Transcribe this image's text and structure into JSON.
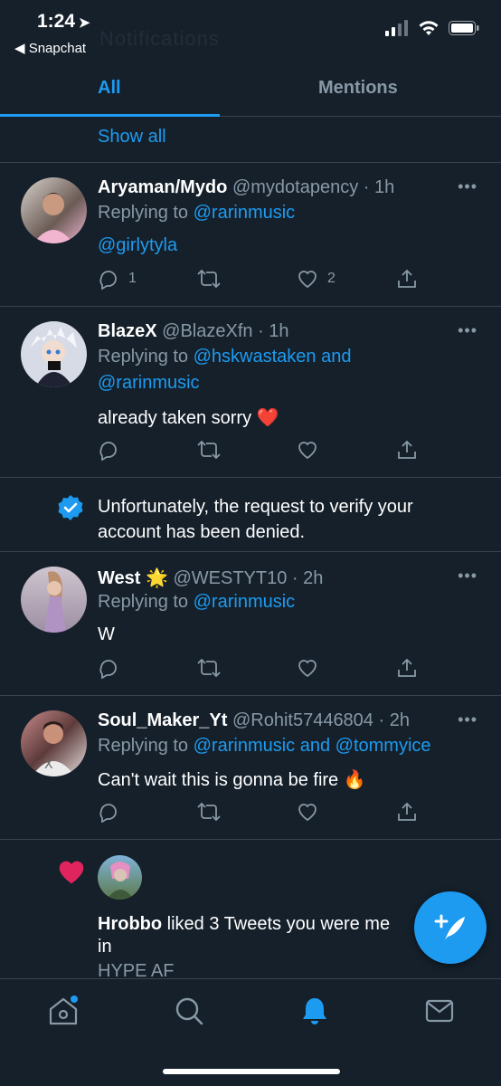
{
  "status_bar": {
    "time": "1:24",
    "back_app": "Snapchat"
  },
  "ghost_header": {
    "title": "Notifications",
    "subtitle": ""
  },
  "tabs": [
    {
      "label": "All",
      "active": true
    },
    {
      "label": "Mentions",
      "active": false
    }
  ],
  "show_all": "Show all",
  "tweets": [
    {
      "name": "Aryaman/Mydo",
      "handle": "@mydotapency",
      "time": "· 1h",
      "replying_prefix": "Replying to ",
      "replying_to": "@rarinmusic",
      "replying_to_line2": "",
      "text": "@girlytyla",
      "text_is_link": true,
      "reply_count": "1",
      "retweet_count": "",
      "like_count": "2"
    },
    {
      "name": "BlazeX",
      "handle": "@BlazeXfn",
      "time": "· 1h",
      "replying_prefix": "Replying to ",
      "replying_to": "@hskwastaken and",
      "replying_to_line2": "@rarinmusic",
      "text": "already taken sorry ❤️",
      "reply_count": "",
      "retweet_count": "",
      "like_count": ""
    },
    {
      "name": "West 🌟",
      "handle": "@WESTYT10",
      "time": "· 2h",
      "replying_prefix": "Replying to ",
      "replying_to": "@rarinmusic",
      "replying_to_line2": "",
      "text": "W",
      "reply_count": "",
      "retweet_count": "",
      "like_count": ""
    },
    {
      "name": "Soul_Maker_Yt",
      "handle": "@Rohit57446804",
      "time": "· 2h",
      "replying_prefix": "Replying to ",
      "replying_to": "@rarinmusic and @tommyice",
      "replying_to_line2": "",
      "text": "Can't wait this is gonna be fire 🔥",
      "reply_count": "",
      "retweet_count": "",
      "like_count": ""
    }
  ],
  "verification_notice": "Unfortunately, the request to verify your account has been denied.",
  "like_notification": {
    "name": "Hrobbo",
    "action_text": " liked 3 Tweets you were me",
    "action_text_line2": "in",
    "preview": "HYPE AF"
  },
  "more_label": "•••",
  "colors": {
    "accent": "#1d9bf0",
    "background": "#15202b",
    "muted": "#8899a6",
    "heart": "#e0245e"
  },
  "icons": [
    "home-icon",
    "search-icon",
    "bell-icon",
    "mail-icon",
    "compose-icon"
  ]
}
